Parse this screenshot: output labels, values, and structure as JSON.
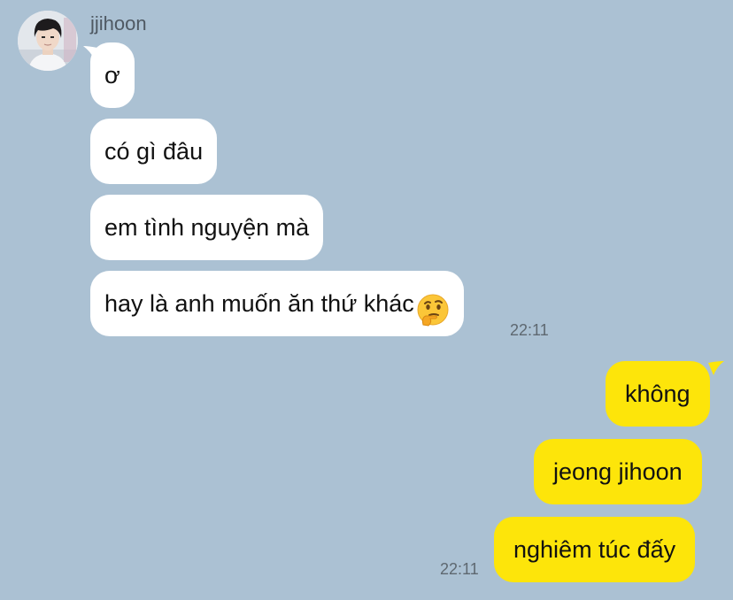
{
  "theme": {
    "background": "#abc1d3",
    "incoming_bubble": "#ffffff",
    "outgoing_bubble": "#fde50a",
    "time_color": "#5e6870"
  },
  "contact": {
    "name": "jjihoon",
    "avatar_icon": "profile-photo"
  },
  "incoming": {
    "messages": [
      {
        "text": "ơ"
      },
      {
        "text": "có gì đâu"
      },
      {
        "text": "em tình nguyện mà"
      },
      {
        "text": "hay là anh muốn ăn thứ khác",
        "emoji": "thinking-face-emoji"
      }
    ],
    "time": "22:11"
  },
  "outgoing": {
    "messages": [
      {
        "text": "không"
      },
      {
        "text": "jeong jihoon"
      },
      {
        "text": "nghiêm túc đấy"
      }
    ],
    "time": "22:11"
  }
}
